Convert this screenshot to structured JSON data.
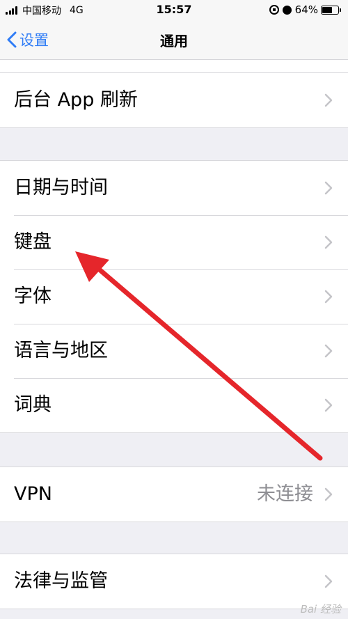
{
  "status_bar": {
    "carrier": "中国移动",
    "network": "4G",
    "time": "15:57",
    "battery_percent": "64%",
    "battery_level": 0.64
  },
  "nav": {
    "back_label": "设置",
    "title": "通用"
  },
  "groups": [
    {
      "rows": [
        {
          "label": "后台 App 刷新"
        }
      ]
    },
    {
      "rows": [
        {
          "label": "日期与时间"
        },
        {
          "label": "键盘"
        },
        {
          "label": "字体"
        },
        {
          "label": "语言与地区"
        },
        {
          "label": "词典"
        }
      ]
    },
    {
      "rows": [
        {
          "label": "VPN",
          "value": "未连接"
        }
      ]
    },
    {
      "rows": [
        {
          "label": "法律与监管"
        }
      ]
    }
  ],
  "annotation": {
    "color": "#e5262b"
  },
  "watermark": "Bai 经验",
  "colors": {
    "accent": "#2f7cf6",
    "background": "#efeff4"
  }
}
